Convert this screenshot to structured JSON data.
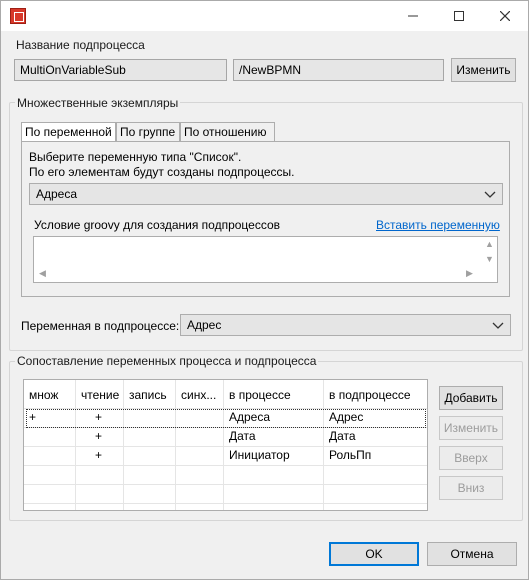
{
  "window": {
    "title_icon": "bpmn-app-icon",
    "controls": {
      "minimize": "—",
      "maximize": "☐",
      "close": "✕"
    }
  },
  "subprocess": {
    "group_label": "Название подпроцесса",
    "name_value": "MultiOnVariableSub",
    "path_value": "/NewBPMN",
    "change_button": "Изменить"
  },
  "multi_instances": {
    "group_label": "Множественные экземпляры",
    "tabs": [
      {
        "label": "По переменной",
        "active": true
      },
      {
        "label": "По группе",
        "active": false
      },
      {
        "label": "По отношению",
        "active": false
      }
    ],
    "hint_line1": "Выберите переменную типа \"Список\".",
    "hint_line2": "По его элементам будут созданы подпроцессы.",
    "list_variable": "Адреса",
    "groovy_label": "Условие groovy для создания подпроцессов",
    "insert_variable_link": "Вставить переменную",
    "groovy_text": ""
  },
  "subprocess_variable": {
    "label": "Переменная в подпроцессе:",
    "value": "Адрес"
  },
  "mapping": {
    "group_label": "Сопоставление переменных процесса и подпроцесса",
    "columns": [
      "множ",
      "чтение",
      "запись",
      "синх...",
      "в процессе",
      "в подпроцессе"
    ],
    "rows": [
      [
        "+",
        "+",
        "",
        "",
        "Адреса",
        "Адрес"
      ],
      [
        "",
        "+",
        "",
        "",
        "Дата",
        "Дата"
      ],
      [
        "",
        "+",
        "",
        "",
        "Инициатор",
        "РольПп"
      ]
    ],
    "buttons": {
      "add": "Добавить",
      "edit": "Изменить",
      "up": "Вверх",
      "down": "Вниз"
    }
  },
  "footer": {
    "ok": "OK",
    "cancel": "Отмена"
  }
}
